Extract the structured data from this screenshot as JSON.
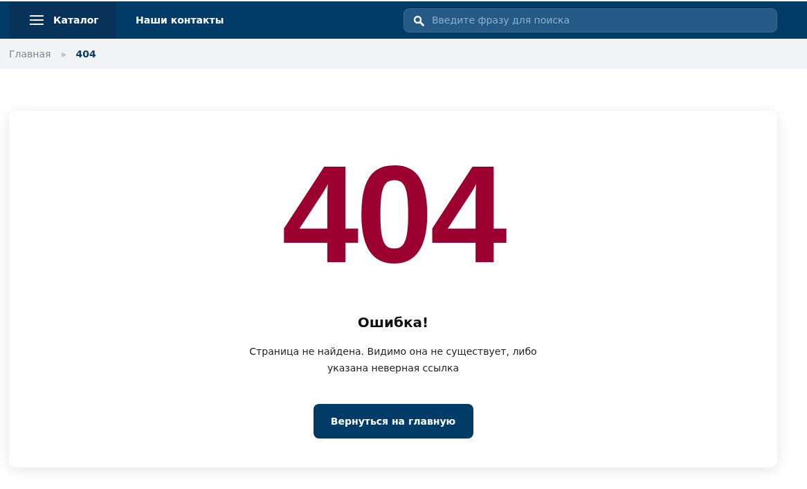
{
  "header": {
    "catalog_button": "Каталог",
    "nav_links": [
      "Наши контакты"
    ],
    "search": {
      "placeholder": "Введите фразу для поиска"
    }
  },
  "breadcrumbs": {
    "items": [
      "Главная"
    ],
    "separator": "»",
    "current": "404"
  },
  "error": {
    "code": "404",
    "title": "Ошибка!",
    "message": "Страница не найдена. Видимо она не существует, либо указана неверная ссылка",
    "button": "Вернуться на главную"
  }
}
